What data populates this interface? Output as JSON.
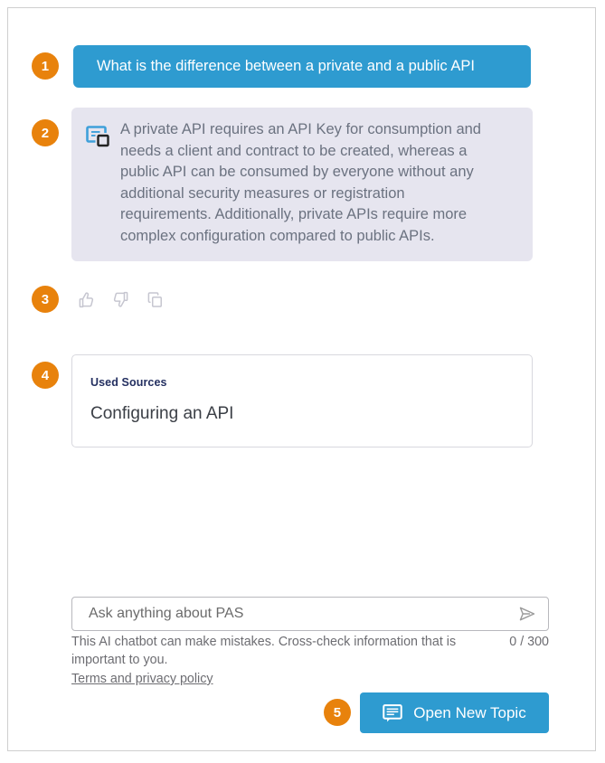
{
  "steps": [
    {
      "number": "1"
    },
    {
      "number": "2"
    },
    {
      "number": "3"
    },
    {
      "number": "4"
    },
    {
      "number": "5"
    }
  ],
  "conversation": {
    "user_message": "What is the difference between a private and a public API",
    "assistant_message": "A private API requires an API Key for consumption and needs a client and contract to be created, whereas a public API can be consumed by everyone without any additional security measures or registration requirements. Additionally, private APIs require more complex configuration compared to public APIs.",
    "assistant_icon": "chatbot-response-icon"
  },
  "feedback": {
    "thumbs_up_icon": "thumbs-up-icon",
    "thumbs_down_icon": "thumbs-down-icon",
    "copy_icon": "copy-icon"
  },
  "sources": {
    "label": "Used Sources",
    "items": [
      {
        "title": "Configuring an API"
      }
    ]
  },
  "composer": {
    "placeholder": "Ask anything about PAS",
    "value": "",
    "send_icon": "send-icon",
    "char_counter": "0 / 300",
    "disclaimer": "This AI chatbot can make mistakes. Cross-check information that is important to you.",
    "terms_link": "Terms and privacy policy"
  },
  "footer": {
    "new_topic_label": "Open New Topic",
    "new_topic_icon": "chat-bubble-icon"
  },
  "colors": {
    "accent_blue": "#2E9BD0",
    "badge_orange": "#E8820C",
    "answer_bg": "#E6E5EF",
    "sources_label": "#243061",
    "muted_text": "#6B7280"
  }
}
